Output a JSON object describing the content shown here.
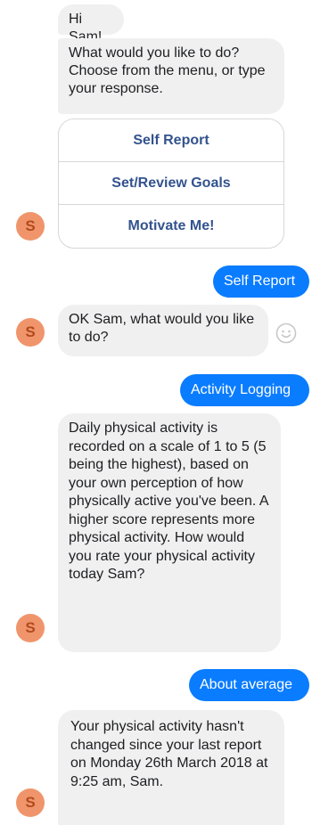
{
  "conversation": {
    "bot_initial": "S",
    "messages": {
      "greeting": "Hi Sam!",
      "prompt": "What would you like to do? Choose from the menu, or type your response.",
      "menu": [
        "Self Report",
        "Set/Review Goals",
        "Motivate Me!"
      ],
      "user_1": "Self Report",
      "bot_2": "OK Sam, what would you like to do?",
      "user_2": "Activity Logging",
      "bot_3": "Daily physical activity is recorded on a scale of 1 to 5 (5 being the highest), based on your own perception of how physically active you've been. A higher score represents more physical activity.  How would you rate your physical activity today Sam?",
      "user_3": "About average",
      "bot_4": "Your physical activity hasn't changed since your last report on Monday 26th March 2018 at 9:25 am, Sam."
    },
    "reaction_icon": "smiley-face-icon"
  },
  "colors": {
    "user_bubble": "#0a7cff",
    "bot_bubble": "#f1f0f0",
    "avatar": "#f0956b",
    "menu_text": "#33538e"
  }
}
